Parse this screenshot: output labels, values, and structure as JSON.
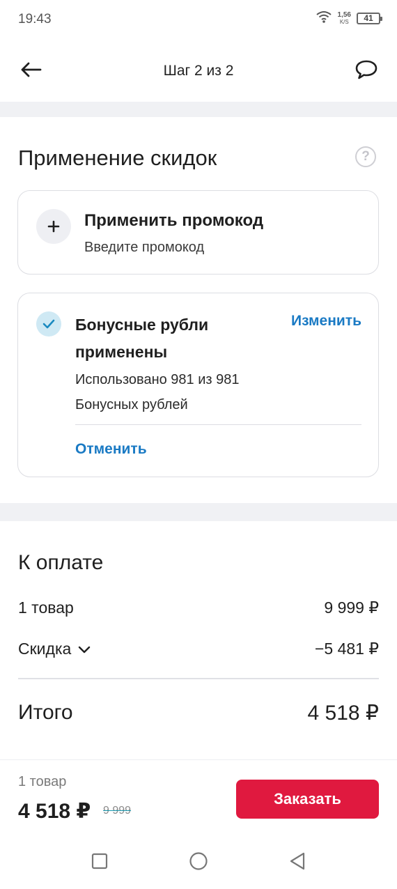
{
  "status_bar": {
    "time": "19:43",
    "net_speed": "1,56",
    "net_speed_unit": "K/S",
    "battery": "41",
    "icons": [
      "wifi-icon",
      "battery-icon"
    ]
  },
  "header": {
    "title": "Шаг 2 из 2",
    "back_icon": "arrow-left-icon",
    "chat_icon": "chat-bubble-icon"
  },
  "discounts": {
    "title": "Применение скидок",
    "help_icon": "?",
    "promo": {
      "icon": "plus-icon",
      "title": "Применить промокод",
      "subtitle": "Введите промокод"
    },
    "bonus": {
      "icon": "check-icon",
      "title": "Бонусные рубли применены",
      "change_label": "Изменить",
      "used_text": "Использовано 981 из 981 Бонусных рублей",
      "cancel_label": "Отменить"
    }
  },
  "payment": {
    "title": "К оплате",
    "items_label": "1 товар",
    "items_value": "9 999 ₽",
    "discount_label": "Скидка",
    "discount_value": "−5 481 ₽",
    "total_label": "Итого",
    "total_value": "4 518 ₽"
  },
  "bottom_bar": {
    "count": "1 товар",
    "price": "4 518 ₽",
    "old_price": "9 999",
    "order_label": "Заказать"
  },
  "colors": {
    "accent_blue": "#1a7ac4",
    "order_red": "#e0193f",
    "check_bg": "#cfe9f4"
  }
}
